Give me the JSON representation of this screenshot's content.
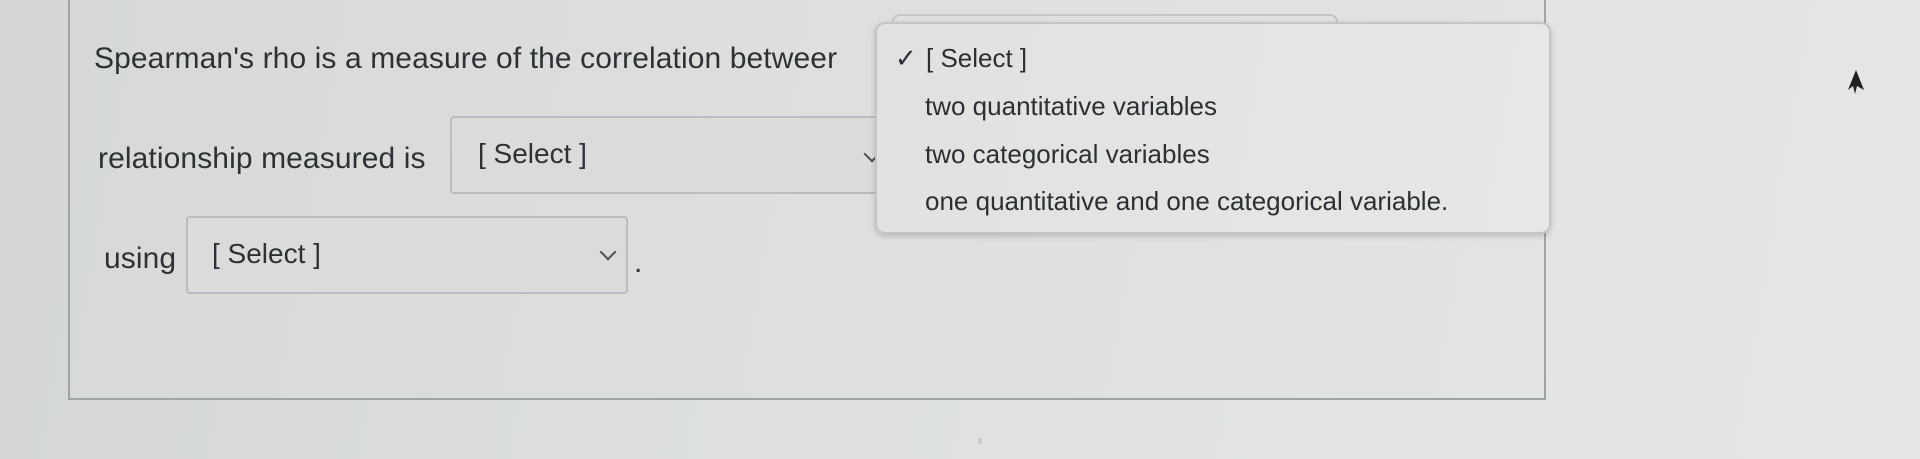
{
  "question": {
    "line1_text": "Spearman's rho is a measure of the correlation betweer",
    "line2_text": "relationship measured is",
    "line3_text": "using",
    "period": "."
  },
  "selects": {
    "between": {
      "value": "[Select]"
    },
    "relationship": {
      "value": "[ Select ]"
    },
    "using": {
      "value": "[ Select ]"
    }
  },
  "dropdown": {
    "selected_mark": "✓",
    "options": [
      {
        "label": "[ Select ]",
        "selected": true
      },
      {
        "label": "two quantitative variables",
        "selected": false
      },
      {
        "label": "two categorical variables",
        "selected": false
      },
      {
        "label": "one quantitative and one categorical variable.",
        "selected": false
      }
    ]
  },
  "colors": {
    "background": "#dcdfdc",
    "card_border": "#9ea3a5",
    "text": "#2e3236"
  }
}
